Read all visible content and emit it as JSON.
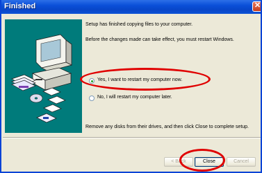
{
  "window": {
    "title": "Finished",
    "close_glyph": "✕"
  },
  "content": {
    "message_1": "Setup has finished copying files to your computer.",
    "message_2": "Before the changes made can take effect, you must restart Windows.",
    "message_3": "Remove any disks from their drives, and then click Close to complete setup."
  },
  "options": [
    {
      "label": "Yes, I want to restart my computer now.",
      "selected": true
    },
    {
      "label": "No, I will restart my computer later.",
      "selected": false
    }
  ],
  "buttons": {
    "back": "< Back",
    "close": "Close",
    "cancel": "Cancel"
  },
  "colors": {
    "side_panel": "#007b7b",
    "title_bar": "#0a4fd8",
    "annotation_ring": "#e00000"
  }
}
